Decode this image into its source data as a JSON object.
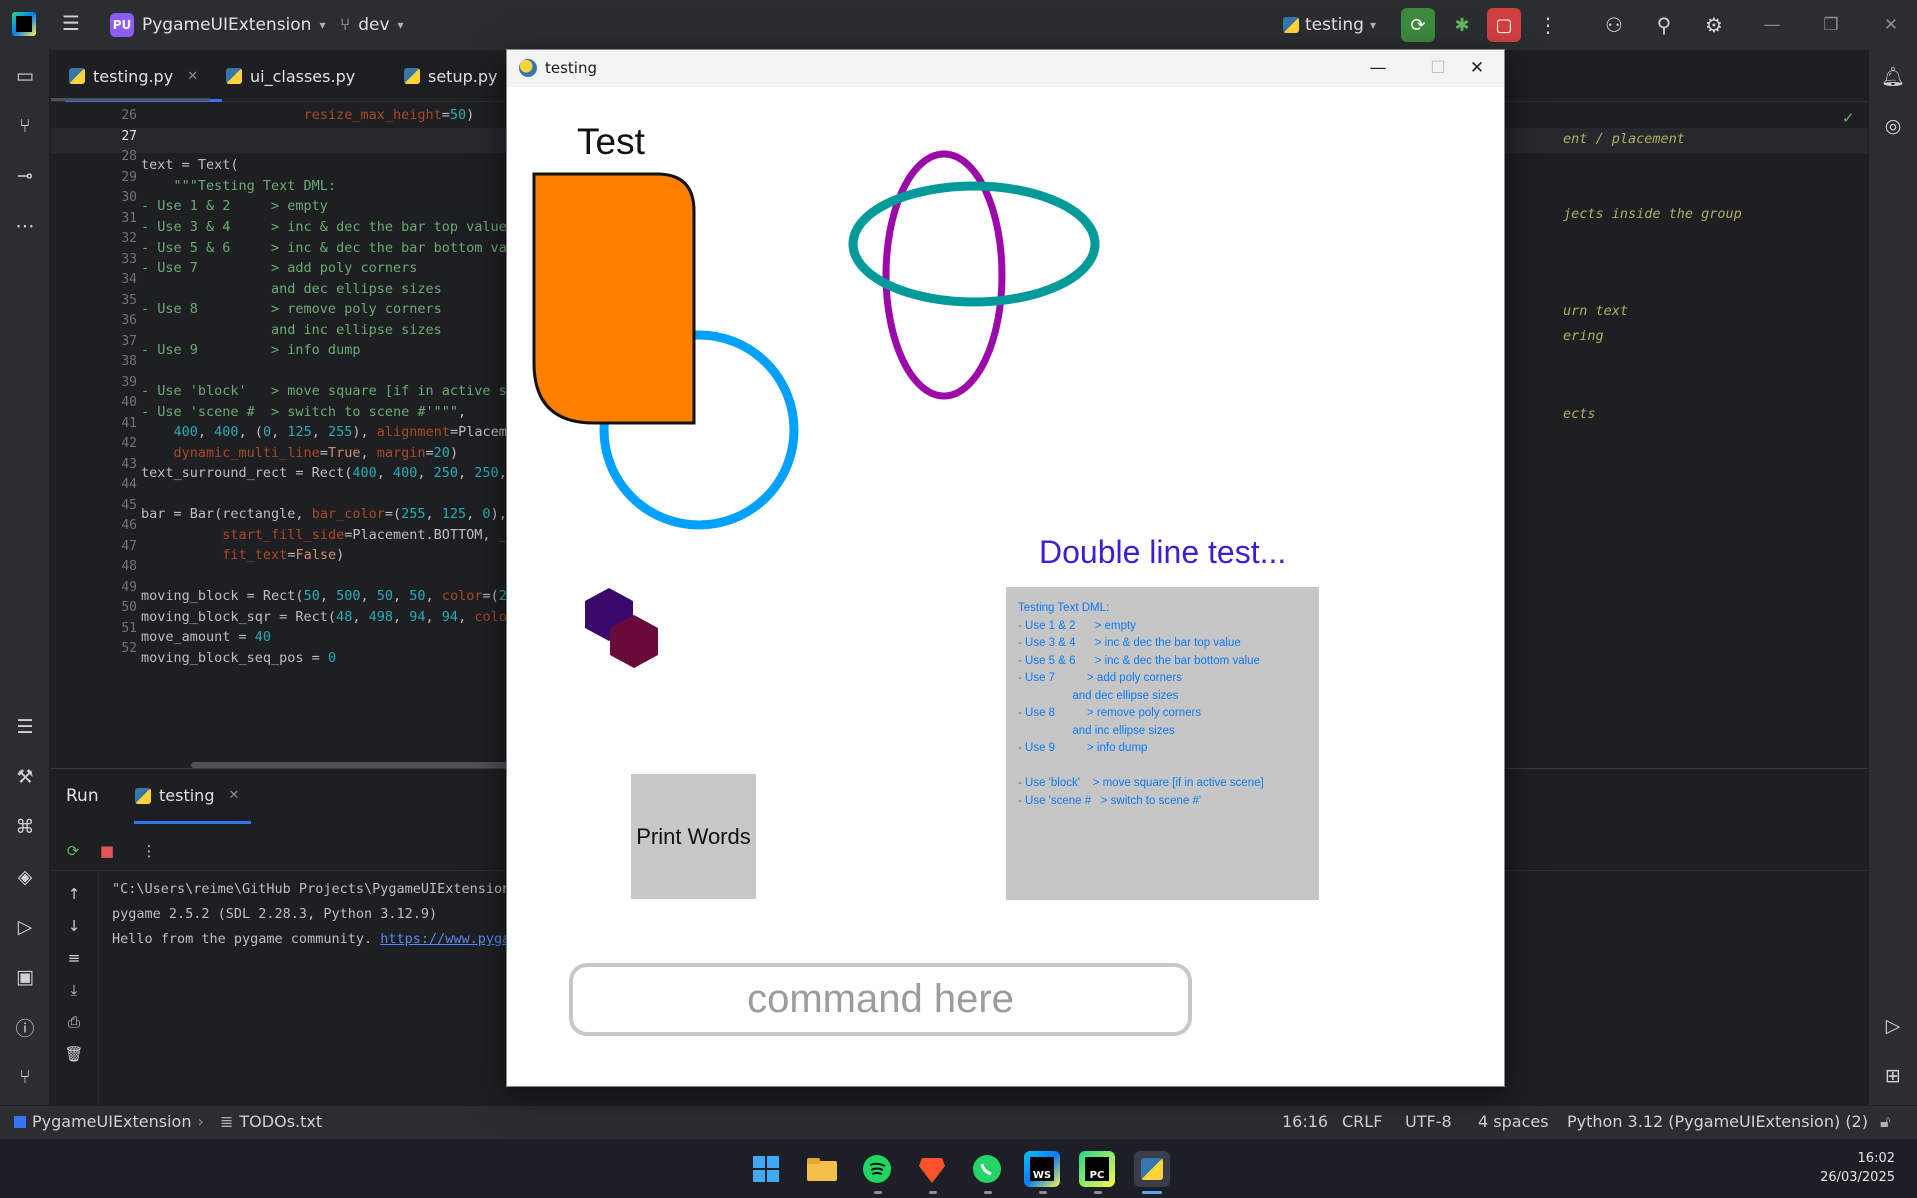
{
  "ide": {
    "project_badge": "PU",
    "project_name": "PygameUIExtension",
    "branch": "dev",
    "run_config": "testing"
  },
  "editor_tabs": [
    {
      "label": "testing.py"
    },
    {
      "label": "ui_classes.py"
    },
    {
      "label": "setup.py"
    }
  ],
  "editor": {
    "line_numbers": [
      "26",
      "27",
      "28",
      "29",
      "30",
      "31",
      "32",
      "33",
      "34",
      "35",
      "36",
      "37",
      "38",
      "39",
      "40",
      "41",
      "42",
      "43",
      "44",
      "45",
      "46",
      "47",
      "48",
      "49",
      "50",
      "51",
      "52"
    ],
    "right_comments": [
      "ent / placement",
      "jects inside the group",
      "urn text",
      "ering",
      "ects"
    ]
  },
  "run_panel": {
    "title": "Run",
    "tab": "testing",
    "console": [
      "\"C:\\Users\\reime\\GitHub Projects\\PygameUIExtension",
      "pygame 2.5.2 (SDL 2.28.3, Python 3.12.9)",
      "Hello from the pygame community. "
    ],
    "console_link": "https://www.pyga"
  },
  "status_bar": {
    "project": "PygameUIExtension",
    "file": "TODOs.txt",
    "position": "16:16",
    "line_ending": "CRLF",
    "encoding": "UTF-8",
    "indent": "4 spaces",
    "interpreter": "Python 3.12 (PygameUIExtension) (2)"
  },
  "taskbar": {
    "time": "16:02",
    "date": "26/03/2025"
  },
  "pygame_window": {
    "title": "testing",
    "test_label": "Test",
    "double_line_title": "Double line test...",
    "text_box_lines": [
      "Testing Text DML:",
      "- Use 1 & 2      > empty",
      "- Use 3 & 4      > inc & dec the bar top value",
      "- Use 5 & 6      > inc & dec the bar bottom value",
      "- Use 7          > add poly corners",
      "                 and dec ellipse sizes",
      "- Use 8          > remove poly corners",
      "                 and inc ellipse sizes",
      "- Use 9          > info dump",
      "",
      "- Use 'block'    > move square [if in active scene]",
      "- Use 'scene #   > switch to scene #'"
    ],
    "print_button": "Print Words",
    "command_placeholder": "command here"
  },
  "colors": {
    "accent": "#3574f0",
    "orange_box": "#ff8000",
    "blue_ring": "#00a0ff",
    "purple_ellipse": "#9b0aa8",
    "teal_ellipse": "#009a9a",
    "hex_dark_purple": "#3a0a6a",
    "hex_maroon": "#6a0a3a",
    "double_line_color": "#3b1fd6",
    "text_box_color": "#0e7af2"
  }
}
